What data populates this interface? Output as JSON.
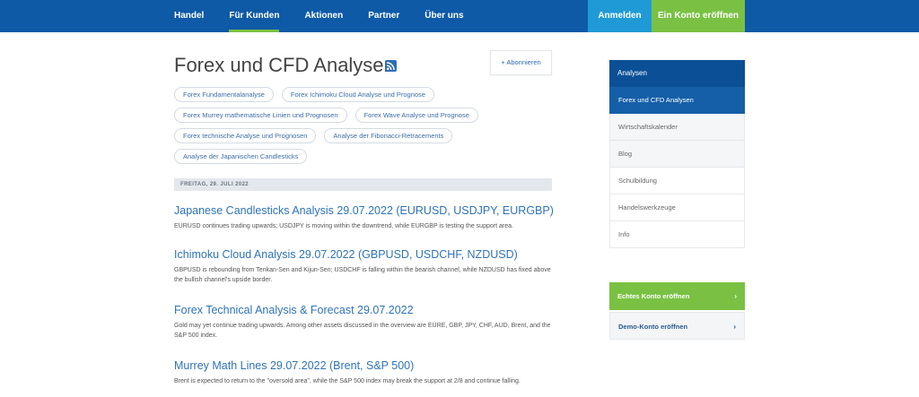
{
  "nav": {
    "items": [
      "Handel",
      "Für Kunden",
      "Aktionen",
      "Partner",
      "Über uns"
    ],
    "active_index": 1,
    "login": "Anmelden",
    "open_account": "Ein Konto eröffnen"
  },
  "page": {
    "title": "Forex und CFD Analysen",
    "subscribe": "+ Abonnieren"
  },
  "chips": [
    [
      "Forex Fundamentalanalyse",
      "Forex Ichimoku Cloud Analyse und Prognose"
    ],
    [
      "Forex Murrey mathematische Linien und Prognosen",
      "Forex Wave Analyse und Prognose"
    ],
    [
      "Forex technische Analyse und Prognosen",
      "Analyse der Fibonacci-Retracements"
    ],
    [
      "Analyse der Japanischen Candlesticks"
    ]
  ],
  "date_label": "FREITAG, 29. JULI 2022",
  "articles": [
    {
      "title": "Japanese Candlesticks Analysis 29.07.2022 (EURUSD, USDJPY, EURGBP)",
      "desc": "EURUSD continues trading upwards; USDJPY is moving within the downtrend, while EURGBP is testing the support area."
    },
    {
      "title": "Ichimoku Cloud Analysis 29.07.2022 (GBPUSD, USDCHF, NZDUSD)",
      "desc": "GBPUSD is rebounding from Tenkan-Sen and Kijun-Sen; USDCHF is falling within the bearish channel, while NZDUSD has fixed above the bullish channel's upside border."
    },
    {
      "title": "Forex Technical Analysis & Forecast 29.07.2022",
      "desc": "Gold may yet continue trading upwards. Among other assets discussed in the overview are EURE, GBP, JPY, CHF, AUD, Brent, and the S&P 500 index."
    },
    {
      "title": "Murrey Math Lines 29.07.2022 (Brent, S&P 500)",
      "desc": "Brent is expected to return to the \"oversold area\", while the S&P 500 index may break the support at 2/8 and continue falling."
    }
  ],
  "sidebar": {
    "heading": "Analysen",
    "items": [
      "Forex und CFD Analysen",
      "Wirtschaftskalender",
      "Blog",
      "Schulbildung",
      "Handelswerkzeuge",
      "Info"
    ],
    "active_index": 0
  },
  "cta": {
    "real": "Echtes Konto eröffnen",
    "demo": "Demo-Konto eröffnen",
    "arrow": "›"
  },
  "colors": {
    "header": "#0e5aa7",
    "accent_green": "#7ac143",
    "login_blue": "#1f9ad6",
    "link_blue": "#2e73b8"
  }
}
